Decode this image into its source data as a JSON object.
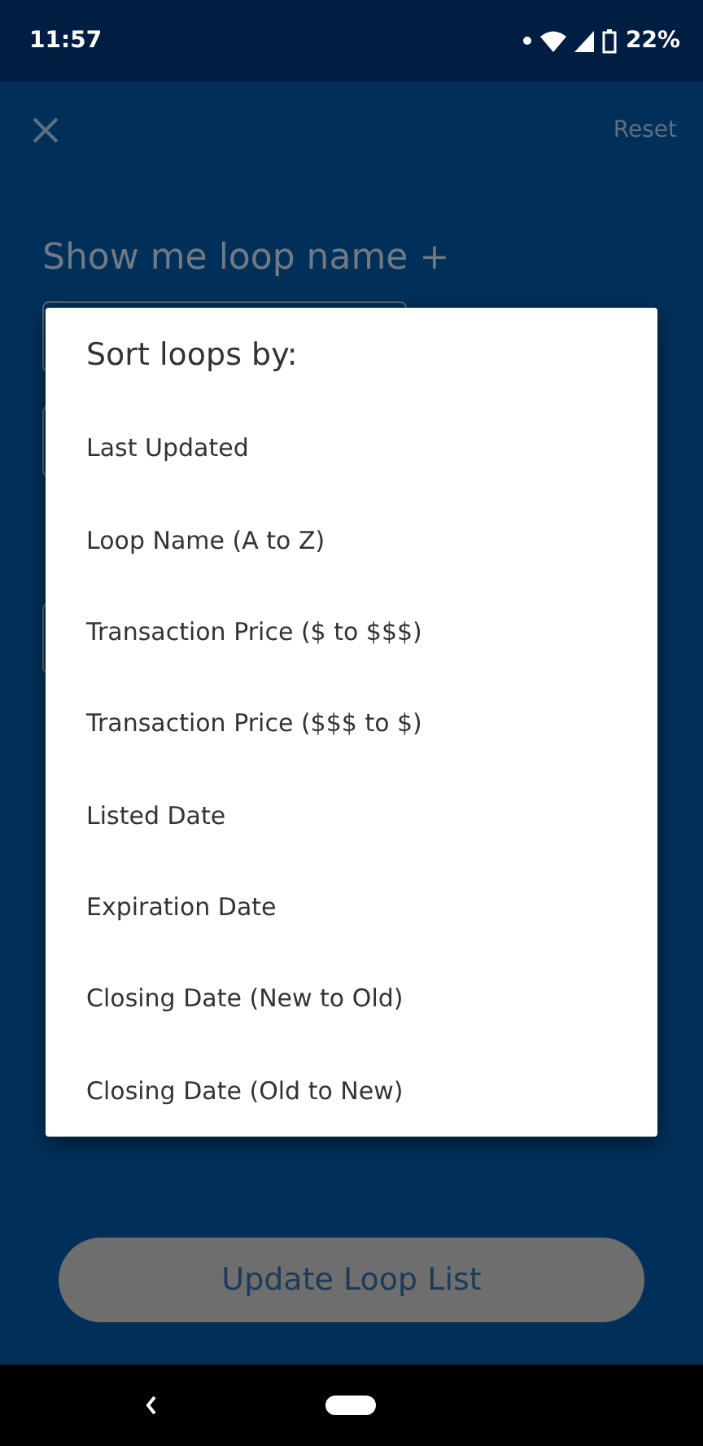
{
  "status_bar": {
    "time": "11:57",
    "battery": "22%"
  },
  "header": {
    "reset": "Reset"
  },
  "title": "Show me loop name +",
  "dialog": {
    "title": "Sort loops by:",
    "options": [
      {
        "label": "Last Updated"
      },
      {
        "label": "Loop Name (A to Z)"
      },
      {
        "label": "Transaction Price ($ to $$$)"
      },
      {
        "label": "Transaction Price ($$$ to $)"
      },
      {
        "label": "Listed Date"
      },
      {
        "label": "Expiration Date"
      },
      {
        "label": "Closing Date (New to Old)"
      },
      {
        "label": "Closing Date (Old to New)"
      }
    ]
  },
  "update_button": {
    "label": "Update Loop List",
    "disabled": true
  }
}
